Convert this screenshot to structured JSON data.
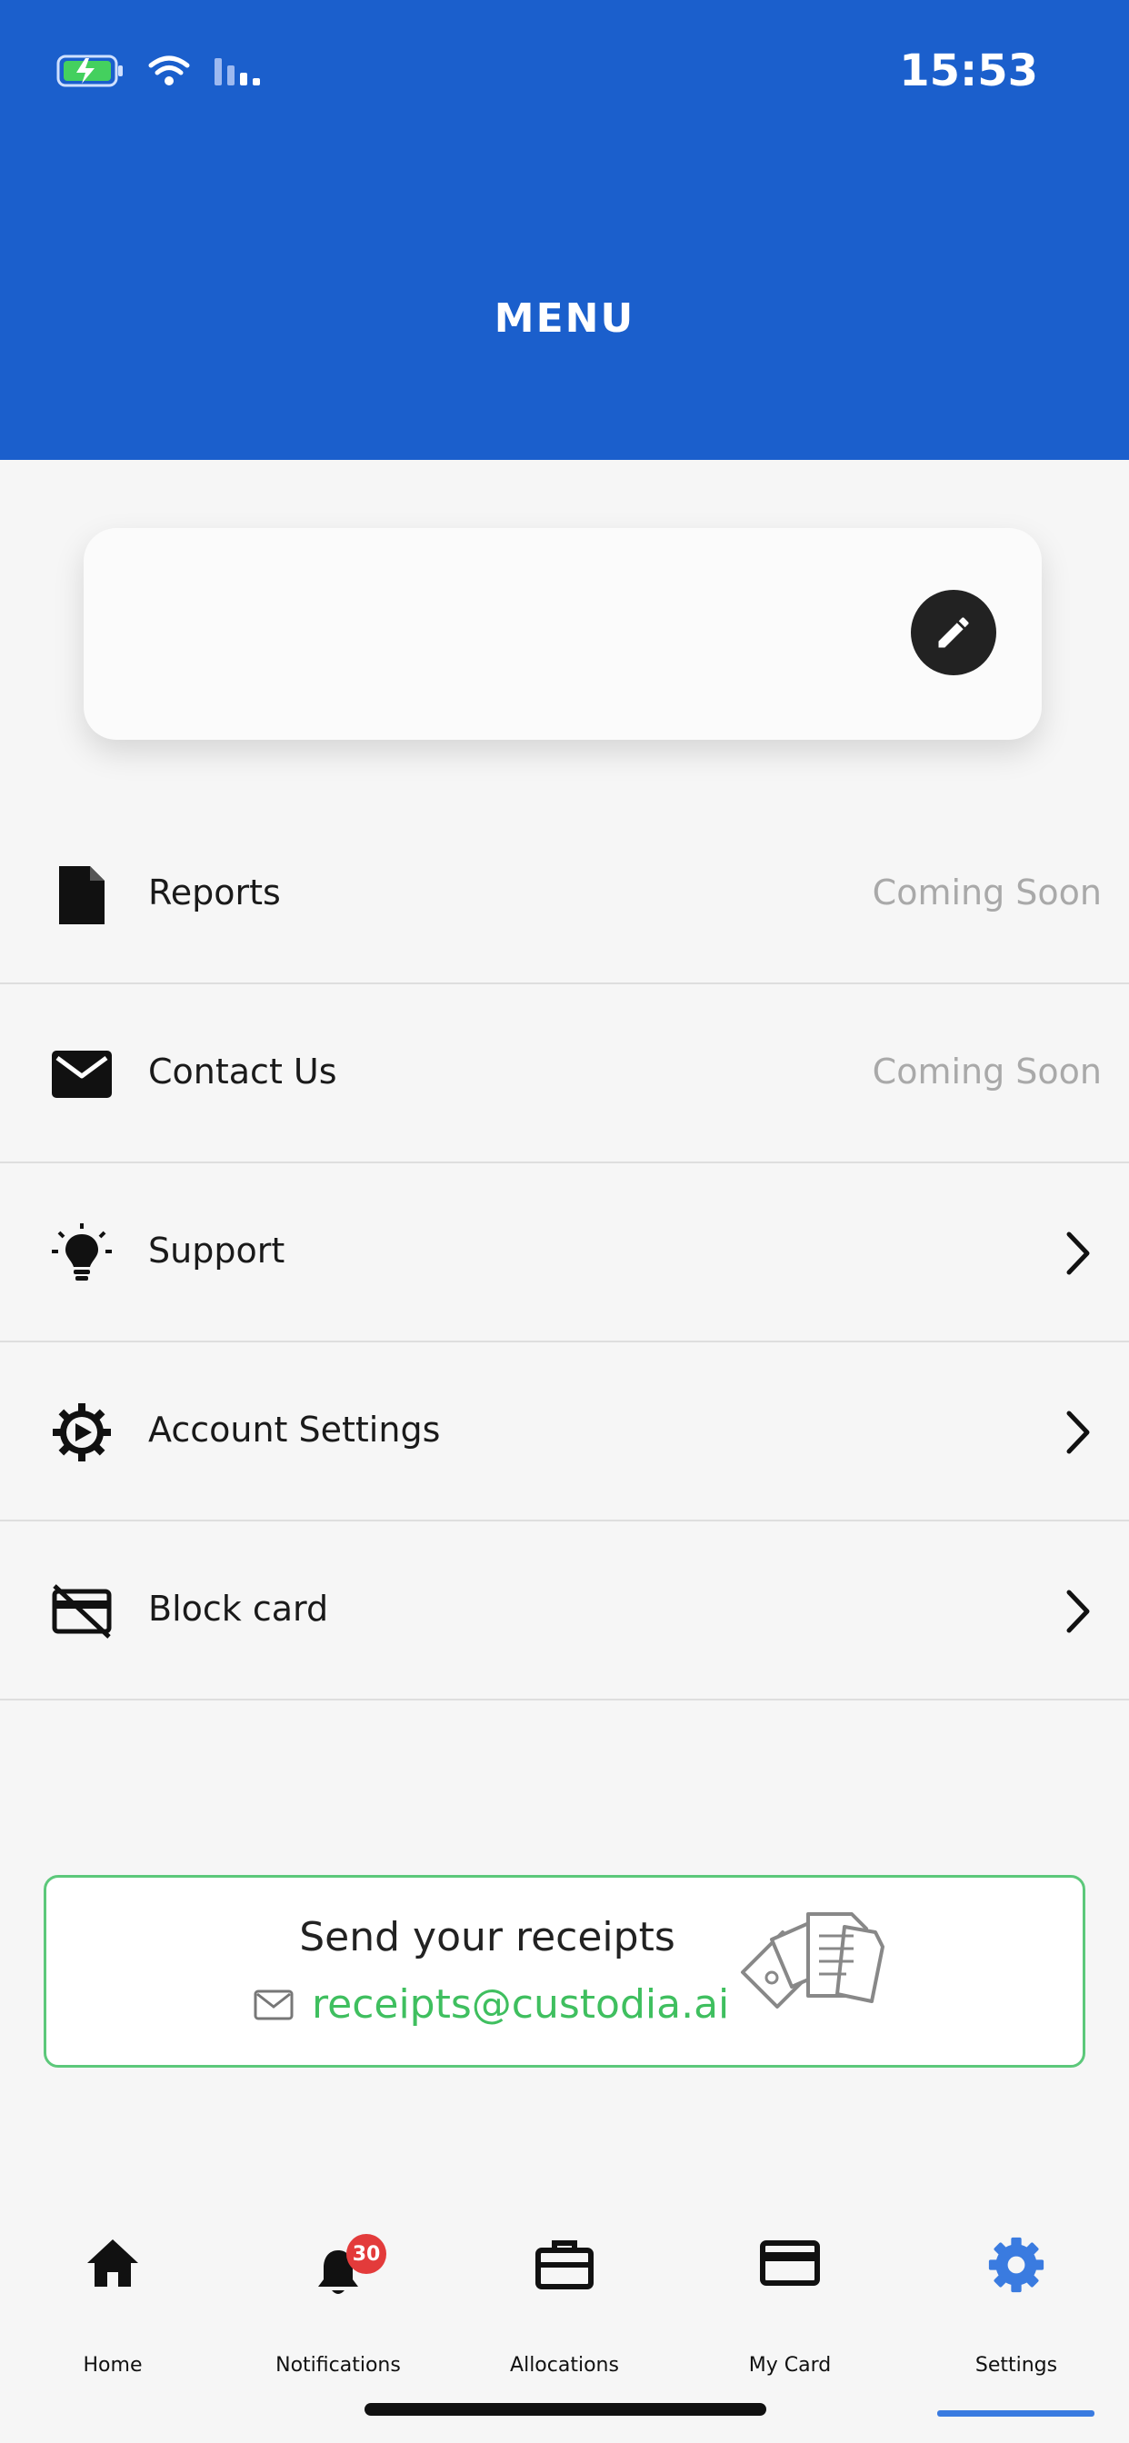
{
  "status_bar": {
    "time": "15:53"
  },
  "header": {
    "title": "MENU"
  },
  "menu": {
    "items": [
      {
        "label": "Reports",
        "status": "Coming Soon",
        "icon": "document-icon"
      },
      {
        "label": "Contact Us",
        "status": "Coming Soon",
        "icon": "envelope-icon"
      },
      {
        "label": "Support",
        "icon": "lightbulb-icon"
      },
      {
        "label": "Account Settings",
        "icon": "gear-icon"
      },
      {
        "label": "Block card",
        "icon": "card-blocked-icon"
      }
    ]
  },
  "receipts": {
    "title": "Send your receipts",
    "email": "receipts@custodia.ai"
  },
  "bottom_nav": {
    "items": [
      {
        "label": "Home",
        "icon": "home-icon"
      },
      {
        "label": "Notifications",
        "icon": "bell-icon",
        "badge": "30"
      },
      {
        "label": "Allocations",
        "icon": "briefcase-icon"
      },
      {
        "label": "My Card",
        "icon": "credit-card-icon"
      },
      {
        "label": "Settings",
        "icon": "gear-icon",
        "active": true
      }
    ]
  },
  "colors": {
    "header_bg": "#1b5fcc",
    "accent_green": "#3fbf5f",
    "active_nav": "#3a7be0",
    "badge_red": "#e33b3b"
  }
}
